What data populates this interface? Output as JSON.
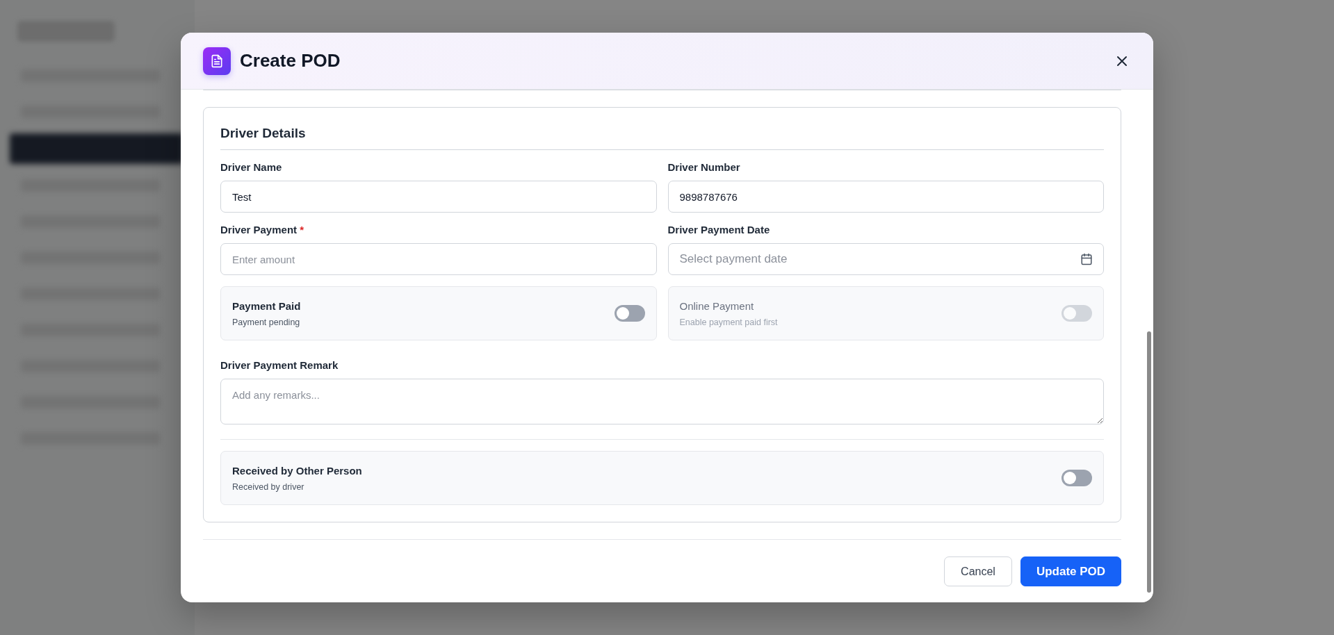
{
  "modal": {
    "title": "Create POD"
  },
  "section": {
    "title": "Driver Details",
    "fields": [
      {
        "kind": "input",
        "label": "Driver Name",
        "value": "Test"
      },
      {
        "kind": "input",
        "label": "Driver Number",
        "value": "9898787676"
      },
      {
        "kind": "input",
        "label": "Driver Payment",
        "required_mark": "*",
        "placeholder": "Enter amount"
      },
      {
        "kind": "date",
        "label": "Driver Payment Date",
        "placeholder": "Select payment date"
      }
    ],
    "toggles": [
      {
        "title": "Payment Paid",
        "subtitle": "Payment pending",
        "on": false,
        "disabled": false
      },
      {
        "title": "Online Payment",
        "subtitle": "Enable payment paid first",
        "on": false,
        "disabled": true
      }
    ],
    "remark": {
      "label": "Driver Payment Remark",
      "placeholder": "Add any remarks..."
    },
    "bottom_toggle": {
      "title": "Received by Other Person",
      "subtitle": "Received by driver",
      "on": false,
      "disabled": false
    }
  },
  "buttons": [
    {
      "kind": "secondary",
      "label": "Cancel"
    },
    {
      "kind": "primary",
      "label": "Update POD"
    }
  ]
}
